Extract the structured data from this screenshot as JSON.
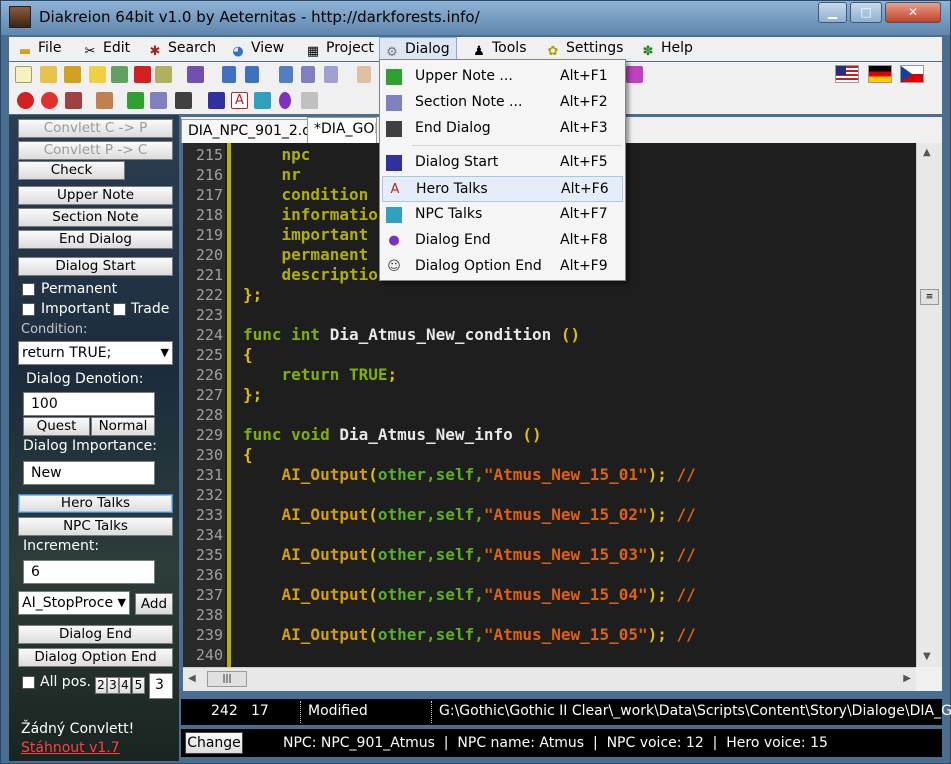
{
  "window": {
    "title": "Diakreion 64bit v1.0 by Aeternitas - http://darkforests.info/",
    "minimize_glyph": "▁",
    "maximize_glyph": "□",
    "close_glyph": "✕"
  },
  "menubar": {
    "items": [
      {
        "label": "File",
        "icon": "folder-icon"
      },
      {
        "label": "Edit",
        "icon": "tools-icon"
      },
      {
        "label": "Search",
        "icon": "search-icon"
      },
      {
        "label": "View",
        "icon": "color-wheel-icon"
      },
      {
        "label": "Project",
        "icon": "project-icon"
      },
      {
        "label": "Dialog",
        "icon": "dialog-icon"
      },
      {
        "label": "Tools",
        "icon": "figure-icon"
      },
      {
        "label": "Settings",
        "icon": "settings-icon"
      },
      {
        "label": "Help",
        "icon": "help-icon"
      }
    ]
  },
  "dialog_menu": {
    "items": [
      {
        "label": "Upper Note ...",
        "shortcut": "Alt+F1"
      },
      {
        "label": "Section Note ...",
        "shortcut": "Alt+F2"
      },
      {
        "label": "End Dialog",
        "shortcut": "Alt+F3"
      },
      {
        "label": "Dialog Start",
        "shortcut": "Alt+F5"
      },
      {
        "label": "Hero Talks",
        "shortcut": "Alt+F6"
      },
      {
        "label": "NPC Talks",
        "shortcut": "Alt+F7"
      },
      {
        "label": "Dialog End",
        "shortcut": "Alt+F8"
      },
      {
        "label": "Dialog Option End",
        "shortcut": "Alt+F9"
      }
    ]
  },
  "left_panel": {
    "convlett_c_p": "Convlett C -> P",
    "convlett_p_c": "Convlett P -> C",
    "check": "Check",
    "upper_note": "Upper Note",
    "section_note": "Section Note",
    "end_dialog": "End Dialog",
    "dialog_start": "Dialog Start",
    "permanent": "Permanent",
    "important": "Important",
    "trade": "Trade",
    "condition_label": "Condition:",
    "condition_value": "return TRUE;",
    "dialog_denotion_label": "Dialog Denotion:",
    "dialog_denotion_value": "100",
    "quest": "Quest",
    "normal": "Normal",
    "dialog_importance_label": "Dialog Importance:",
    "dialog_importance_value": "New",
    "hero_talks": "Hero Talks",
    "npc_talks": "NPC Talks",
    "increment_label": "Increment:",
    "increment_value": "6",
    "ai_select_value": "AI_StopProce",
    "add": "Add",
    "dialog_end": "Dialog End",
    "dialog_option_end": "Dialog Option End",
    "all_pos": "All pos.",
    "pos_numbers": [
      "2",
      "3",
      "4",
      "5"
    ],
    "pos_value": "3",
    "no_convlett": "Žádný Convlett!",
    "download": "Stáhnout v1.7"
  },
  "tabs": [
    {
      "label": "DIA_NPC_901_2.d"
    },
    {
      "label": "*DIA_GOR"
    }
  ],
  "editor": {
    "lines": [
      {
        "n": "215",
        "parts": [
          [
            "    ",
            "id"
          ],
          [
            "npc",
            "kw2"
          ]
        ]
      },
      {
        "n": "216",
        "parts": [
          [
            "    ",
            "id"
          ],
          [
            "nr",
            "kw2"
          ]
        ]
      },
      {
        "n": "217",
        "parts": [
          [
            "    ",
            "id"
          ],
          [
            "condition",
            "kw2"
          ],
          [
            "                   ",
            "id"
          ],
          [
            "tion",
            "id"
          ],
          [
            ";",
            "par"
          ]
        ]
      },
      {
        "n": "218",
        "parts": [
          [
            "    ",
            "id"
          ],
          [
            "information",
            "kw2"
          ]
        ]
      },
      {
        "n": "219",
        "parts": [
          [
            "    ",
            "id"
          ],
          [
            "important",
            "kw2"
          ]
        ]
      },
      {
        "n": "220",
        "parts": [
          [
            "    ",
            "id"
          ],
          [
            "permanent",
            "kw2"
          ]
        ]
      },
      {
        "n": "221",
        "parts": [
          [
            "    ",
            "id"
          ],
          [
            "description",
            "kw2"
          ]
        ]
      },
      {
        "n": "222",
        "parts": [
          [
            "};",
            "par"
          ]
        ]
      },
      {
        "n": "223",
        "parts": []
      },
      {
        "n": "224",
        "parts": [
          [
            "func int ",
            "kw"
          ],
          [
            "Dia_Atmus_New_condition ",
            "id"
          ],
          [
            "()",
            "par"
          ]
        ]
      },
      {
        "n": "225",
        "parts": [
          [
            "{",
            "par"
          ]
        ]
      },
      {
        "n": "226",
        "parts": [
          [
            "    ",
            "id"
          ],
          [
            "return TRUE",
            "kw"
          ],
          [
            ";",
            "par"
          ]
        ]
      },
      {
        "n": "227",
        "parts": [
          [
            "};",
            "par"
          ]
        ]
      },
      {
        "n": "228",
        "parts": []
      },
      {
        "n": "229",
        "parts": [
          [
            "func void ",
            "kw"
          ],
          [
            "Dia_Atmus_New_info ",
            "id"
          ],
          [
            "()",
            "par"
          ]
        ]
      },
      {
        "n": "230",
        "parts": [
          [
            "{",
            "par"
          ]
        ]
      },
      {
        "n": "231",
        "parts": [
          [
            "    ",
            "id"
          ],
          [
            "AI_Output",
            "fn"
          ],
          [
            "(",
            "par"
          ],
          [
            "other,self,",
            "oth"
          ],
          [
            "\"Atmus_New_15_01\"",
            "str"
          ],
          [
            "); ",
            "par"
          ],
          [
            "//",
            "str"
          ]
        ]
      },
      {
        "n": "232",
        "parts": []
      },
      {
        "n": "233",
        "parts": [
          [
            "    ",
            "id"
          ],
          [
            "AI_Output",
            "fn"
          ],
          [
            "(",
            "par"
          ],
          [
            "other,self,",
            "oth"
          ],
          [
            "\"Atmus_New_15_02\"",
            "str"
          ],
          [
            "); ",
            "par"
          ],
          [
            "//",
            "str"
          ]
        ]
      },
      {
        "n": "234",
        "parts": []
      },
      {
        "n": "235",
        "parts": [
          [
            "    ",
            "id"
          ],
          [
            "AI_Output",
            "fn"
          ],
          [
            "(",
            "par"
          ],
          [
            "other,self,",
            "oth"
          ],
          [
            "\"Atmus_New_15_03\"",
            "str"
          ],
          [
            "); ",
            "par"
          ],
          [
            "//",
            "str"
          ]
        ]
      },
      {
        "n": "236",
        "parts": []
      },
      {
        "n": "237",
        "parts": [
          [
            "    ",
            "id"
          ],
          [
            "AI_Output",
            "fn"
          ],
          [
            "(",
            "par"
          ],
          [
            "other,self,",
            "oth"
          ],
          [
            "\"Atmus_New_15_04\"",
            "str"
          ],
          [
            "); ",
            "par"
          ],
          [
            "//",
            "str"
          ]
        ]
      },
      {
        "n": "238",
        "parts": []
      },
      {
        "n": "239",
        "parts": [
          [
            "    ",
            "id"
          ],
          [
            "AI_Output",
            "fn"
          ],
          [
            "(",
            "par"
          ],
          [
            "other,self,",
            "oth"
          ],
          [
            "\"Atmus_New_15_05\"",
            "str"
          ],
          [
            "); ",
            "par"
          ],
          [
            "//",
            "str"
          ]
        ]
      },
      {
        "n": "240",
        "parts": []
      }
    ]
  },
  "status": {
    "line": "242",
    "column": "17",
    "state": "Modified",
    "path": "G:\\Gothic\\Gothic II Clear\\_work\\Data\\Scripts\\Content\\Story\\Dialoge\\DIA_GO",
    "change": "Change",
    "npc_info": "NPC: NPC_901_Atmus  |  NPC name: Atmus  |  NPC voice: 12  |  Hero voice: 15"
  },
  "flags": [
    "us-flag",
    "de-flag",
    "cz-flag"
  ],
  "colors": {
    "editor_bg": "#1e1e1e",
    "keyword": "#80b000",
    "string": "#e06010",
    "function": "#d4a000",
    "download_link": "#ff4040"
  }
}
